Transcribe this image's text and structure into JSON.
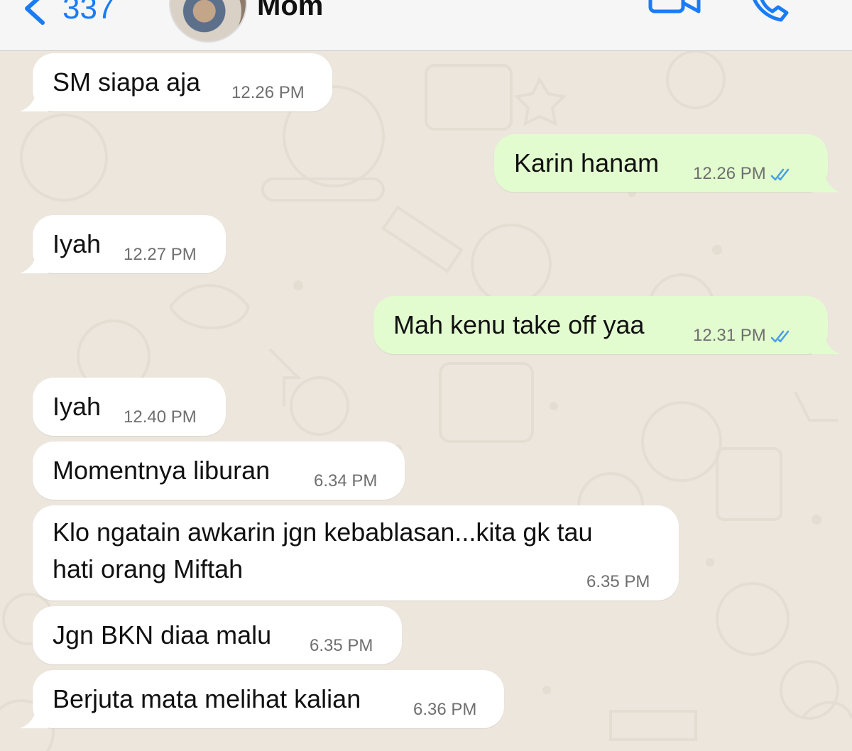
{
  "header": {
    "back_count": "337",
    "contact_name": "Mom"
  },
  "messages": [
    {
      "dir": "in",
      "text": "SM siapa aja",
      "time": "12.26 PM"
    },
    {
      "dir": "out",
      "text": "Karin hanam",
      "time": "12.26 PM",
      "read": true
    },
    {
      "dir": "in",
      "text": "Iyah",
      "time": "12.27 PM"
    },
    {
      "dir": "out",
      "text": "Mah kenu take off yaa",
      "time": "12.31 PM",
      "read": true
    },
    {
      "dir": "in",
      "text": "Iyah",
      "time": "12.40 PM"
    },
    {
      "dir": "in",
      "text": "Momentnya liburan",
      "time": "6.34 PM"
    },
    {
      "dir": "in",
      "lines": [
        "Klo ngatain awkarin jgn kebablasan...kita gk tau",
        "hati orang Miftah"
      ],
      "time": "6.35 PM"
    },
    {
      "dir": "in",
      "text": "Jgn BKN diaa malu",
      "time": "6.35 PM"
    },
    {
      "dir": "in",
      "text": "Berjuta mata melihat kalian",
      "time": "6.36 PM"
    }
  ],
  "colors": {
    "accent": "#1a7cf5",
    "incoming_bubble": "#ffffff",
    "outgoing_bubble": "#e2fccf",
    "read_ticks": "#4a9fe8",
    "wallpaper": "#ece6dd"
  },
  "icons": {
    "back": "chevron-left-icon",
    "video": "video-camera-icon",
    "call": "phone-icon",
    "read": "double-check-icon"
  }
}
